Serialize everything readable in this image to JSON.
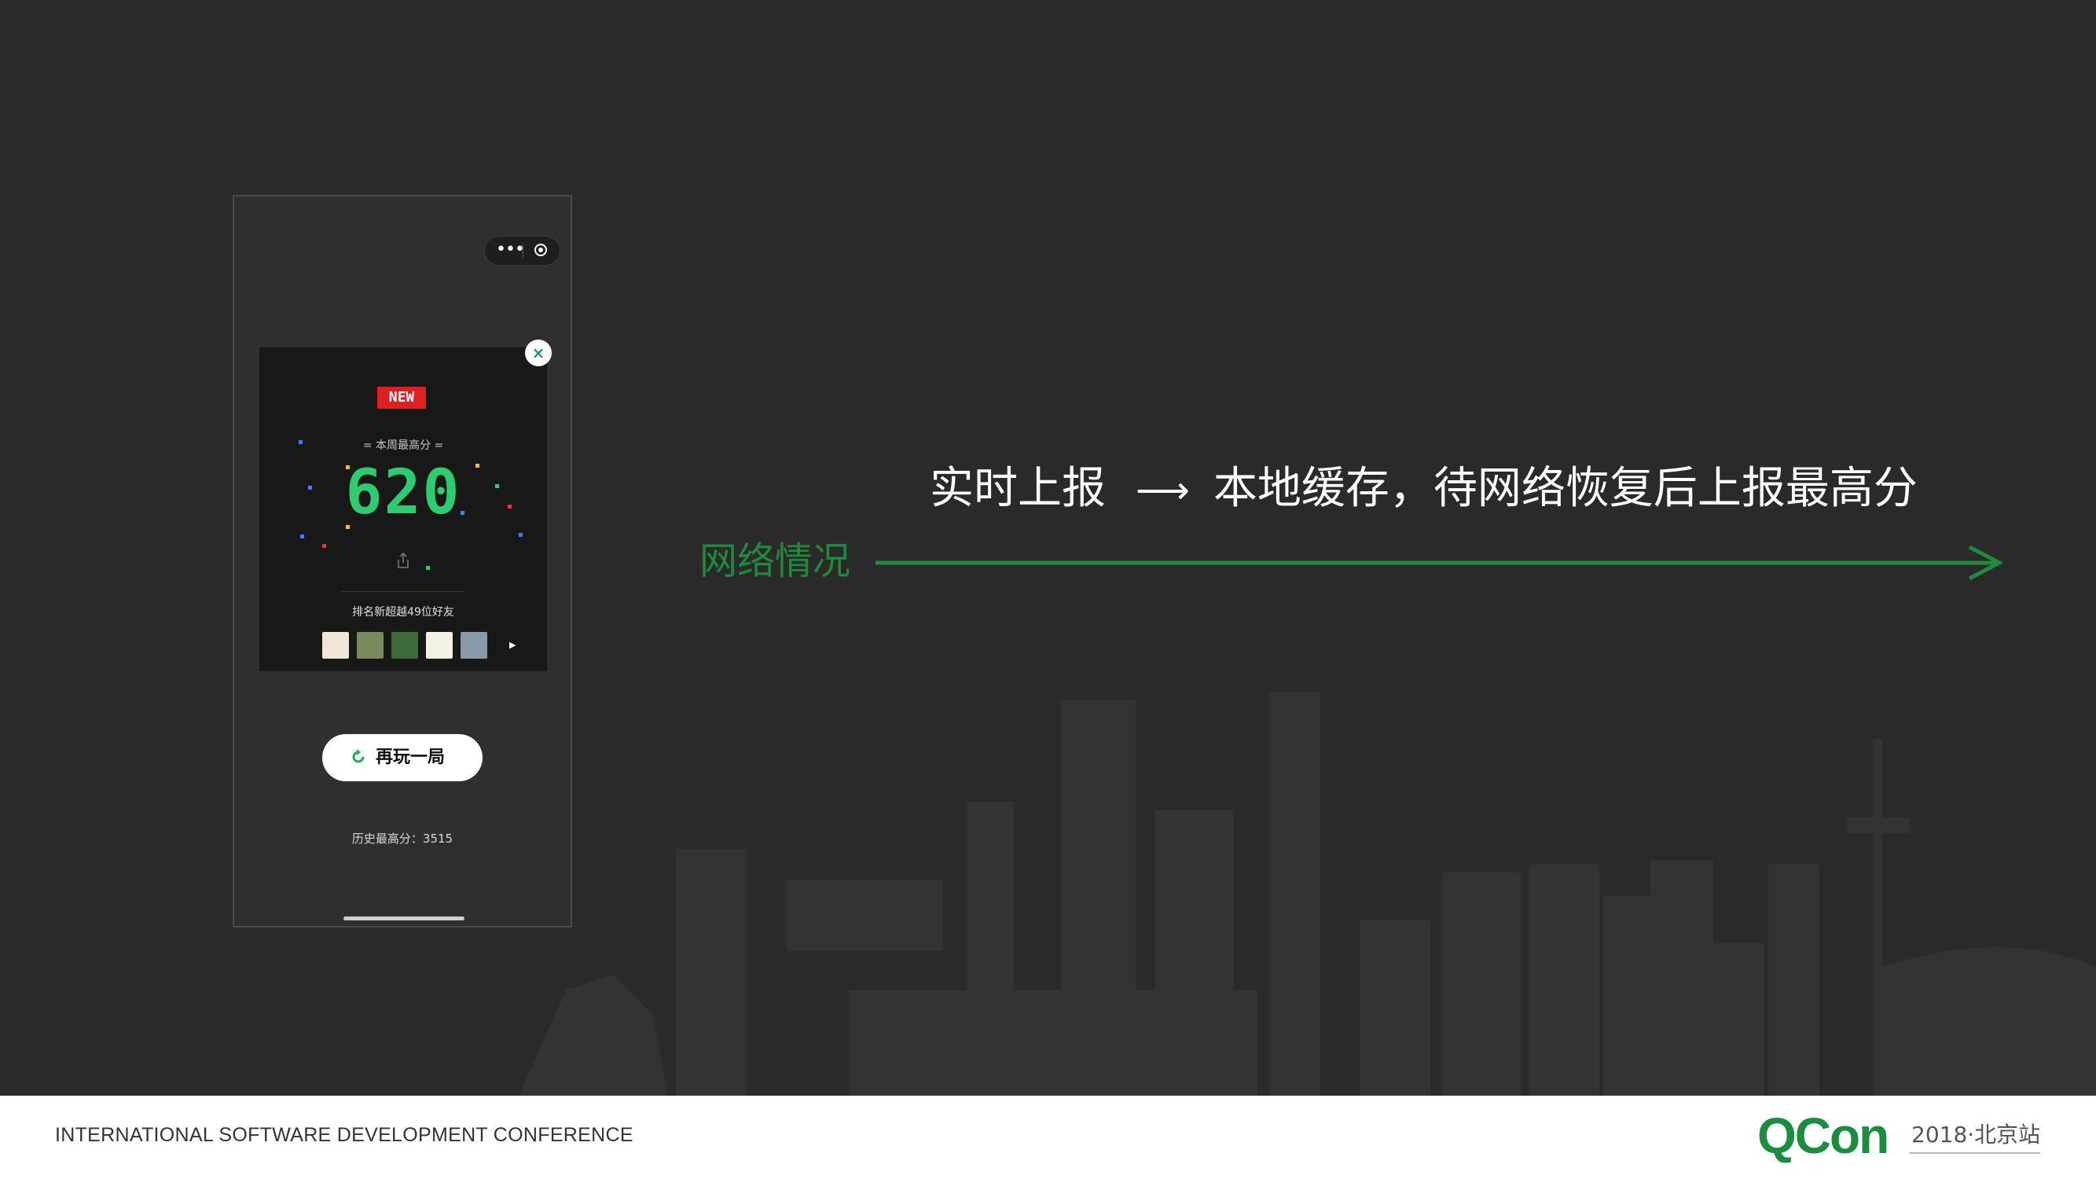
{
  "phone": {
    "capsule": {
      "more_icon": "more-dots-icon",
      "close_icon": "target-circle-icon"
    },
    "card": {
      "badge": "NEW",
      "week_label": "= 本周最高分 =",
      "score": "620",
      "rank_text": "排名新超越49位好友",
      "close_icon": "close-icon",
      "share_icon": "share-icon"
    },
    "play_again": {
      "label": "再玩一局",
      "icon": "refresh-icon"
    },
    "history": "历史最高分：3515"
  },
  "content": {
    "left": "实时上报",
    "arrow": "⟶",
    "right": "本地缓存，待网络恢复后上报最高分",
    "network_label": "网络情况",
    "colors": {
      "accent": "#1f8a3b",
      "text": "#ffffff",
      "background": "#2a2a2a"
    }
  },
  "footer": {
    "conference": "INTERNATIONAL SOFTWARE DEVELOPMENT CONFERENCE",
    "logo": "QCon",
    "edition": "2018·北京站"
  }
}
